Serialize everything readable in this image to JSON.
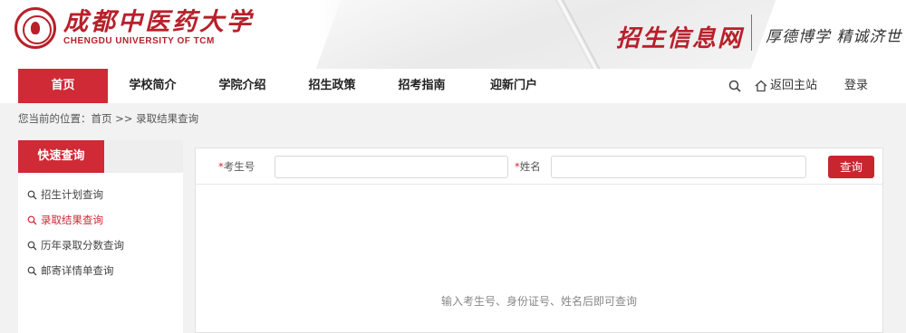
{
  "header": {
    "logo_cn": "成都中医药大学",
    "logo_en": "CHENGDU UNIVERSITY OF TCM",
    "site_title": "招生信息网",
    "motto": "厚德博学 精诚济世"
  },
  "nav": {
    "items": [
      {
        "label": "首页",
        "active": true
      },
      {
        "label": "学校简介"
      },
      {
        "label": "学院介绍"
      },
      {
        "label": "招生政策"
      },
      {
        "label": "招考指南"
      },
      {
        "label": "迎新门户"
      }
    ],
    "back_home": "返回主站",
    "login": "登录"
  },
  "breadcrumb": {
    "prefix": "您当前的位置：",
    "home": "首页",
    "sep": " >> ",
    "current": "录取结果查询"
  },
  "sidebar": {
    "title": "快速查询",
    "items": [
      {
        "label": "招生计划查询"
      },
      {
        "label": "录取结果查询",
        "active": true
      },
      {
        "label": "历年录取分数查询"
      },
      {
        "label": "邮寄详情单查询"
      }
    ]
  },
  "form": {
    "required_mark": "*",
    "exam_no_label": "考生号",
    "exam_no_value": "",
    "name_label": "姓名",
    "name_value": "",
    "submit": "查询"
  },
  "hint": "输入考生号、身份证号、姓名后即可查询",
  "colors": {
    "accent": "#cf2a35",
    "page_bg": "#f2f2f2"
  }
}
